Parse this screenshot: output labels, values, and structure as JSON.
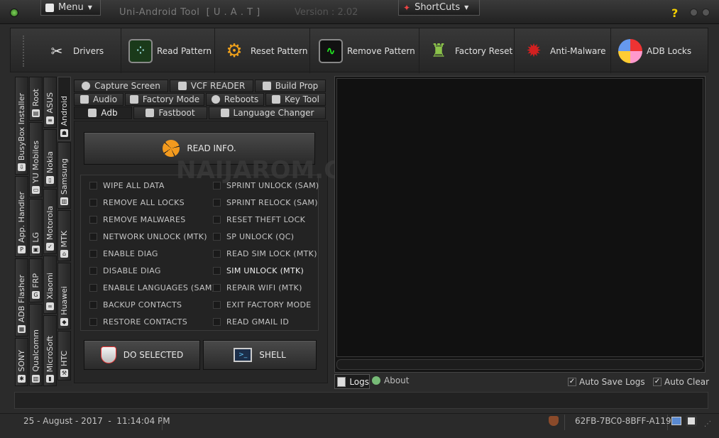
{
  "titlebar": {
    "menu_label": "Menu",
    "app_title": "Uni-Android Tool  [ U . A . T ]",
    "version": "Version :  2.02",
    "shortcuts_label": "ShortCuts"
  },
  "toolbar": {
    "items": [
      {
        "label": "Drivers",
        "icon": "wrench-screwdriver-icon"
      },
      {
        "label": "Read Pattern",
        "icon": "pattern-grid-icon"
      },
      {
        "label": "Reset Pattern",
        "icon": "gears-icon"
      },
      {
        "label": "Remove Pattern",
        "icon": "heartbeat-monitor-icon"
      },
      {
        "label": "Factory Reset",
        "icon": "android-robot-icon"
      },
      {
        "label": "Anti-Malware",
        "icon": "virus-icon"
      },
      {
        "label": "ADB Locks",
        "icon": "pie-chart-icon"
      }
    ]
  },
  "vtabs": {
    "col1": [
      "BusyBox Installer",
      "App. Handler",
      "ADB Flasher",
      "SONY"
    ],
    "col2": [
      "Root",
      "YU Mobiles",
      "LG",
      "FRP",
      "Qualcomm"
    ],
    "col3": [
      "ASUS",
      "Nokia",
      "Motorola",
      "Xiaomi",
      "MicroSoft"
    ],
    "col4": [
      "Android",
      "Samsung",
      "MTK",
      "Huawei",
      "HTC"
    ]
  },
  "htabs": {
    "row1": [
      "Capture Screen",
      "VCF READER",
      "Build Prop"
    ],
    "row2": [
      "Audio",
      "Factory Mode",
      "Reboots",
      "Key Tool"
    ],
    "row3": [
      "Adb",
      "Fastboot",
      "Language Changer"
    ]
  },
  "adb": {
    "read_info": "READ INFO.",
    "left_options": [
      "WIPE ALL DATA",
      "REMOVE ALL LOCKS",
      "REMOVE MALWARES",
      "NETWORK UNLOCK (MTK)",
      "ENABLE DIAG",
      "DISABLE DIAG",
      "ENABLE LANGUAGES (SAM)",
      "BACKUP CONTACTS",
      "RESTORE CONTACTS"
    ],
    "right_options": [
      "SPRINT UNLOCK (SAM)",
      "SPRINT RELOCK (SAM)",
      "RESET THEFT LOCK",
      "SP UNLOCK (QC)",
      "READ SIM LOCK (MTK)",
      "SIM UNLOCK (MTK)",
      "REPAIR WIFI (MTK)",
      "EXIT FACTORY MODE",
      "READ GMAIL ID"
    ],
    "do_selected": "DO SELECTED",
    "shell": "SHELL"
  },
  "watermark": "NAIJAROM.COM",
  "logs": {
    "tab_logs": "Logs",
    "tab_about": "About",
    "auto_save": "Auto Save Logs",
    "auto_clear": "Auto Clear"
  },
  "footer": {
    "datetime": "25 - August - 2017  -  11:14:04 PM",
    "hwid": "62FB-7BC0-8BFF-A119"
  },
  "colors": {
    "accent_orange": "#f39a1e",
    "background": "#2b2b2b"
  }
}
